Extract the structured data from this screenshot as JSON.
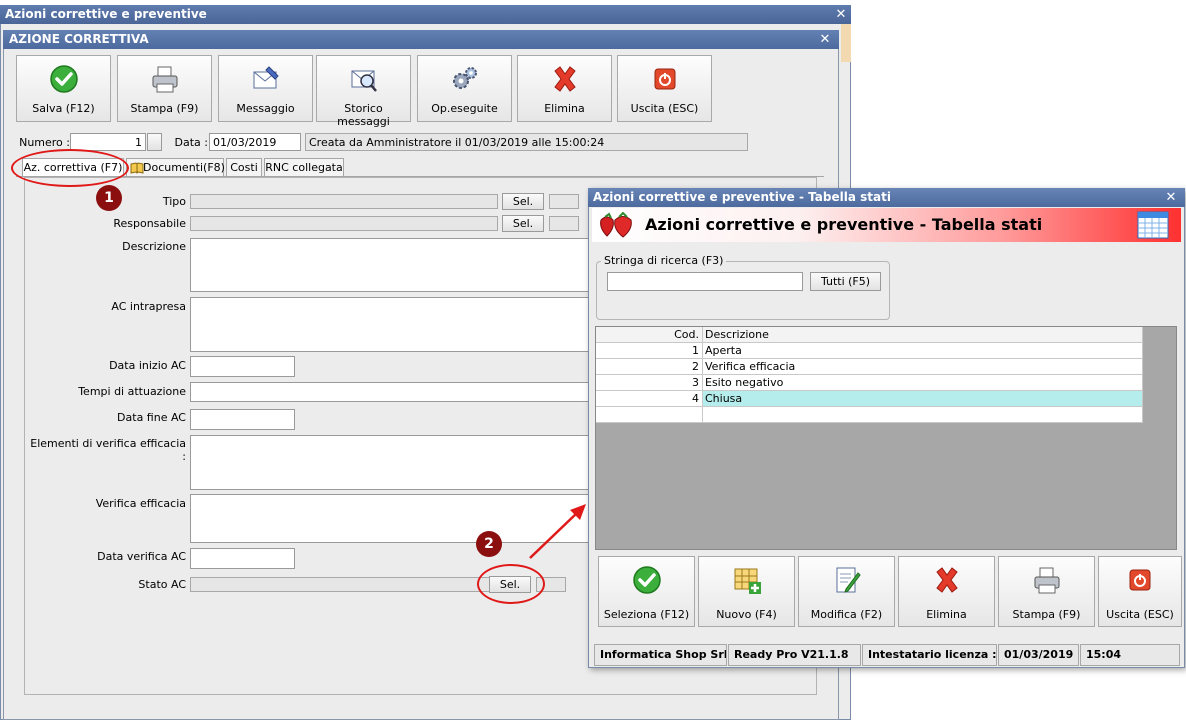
{
  "outer_window": {
    "title": "Azioni correttive e preventive",
    "close": "✕"
  },
  "inner_window": {
    "title": "AZIONE CORRETTIVA",
    "close": "✕"
  },
  "toolbar": [
    {
      "label": "Salva (F12)",
      "icon": "save-check-icon"
    },
    {
      "label": "Stampa (F9)",
      "icon": "printer-icon"
    },
    {
      "label": "Messaggio",
      "icon": "message-icon"
    },
    {
      "label": "Storico messaggi",
      "icon": "message-history-icon"
    },
    {
      "label": "Op.eseguite",
      "icon": "gears-icon"
    },
    {
      "label": "Elimina",
      "icon": "delete-x-icon"
    },
    {
      "label": "Uscita (ESC)",
      "icon": "exit-icon"
    }
  ],
  "header_fields": {
    "numero_label": "Numero :",
    "numero_value": "1",
    "data_label": "Data :",
    "data_value": "01/03/2019",
    "created_info": "Creata da Amministratore il 01/03/2019 alle 15:00:24"
  },
  "tabs": [
    "Az. correttiva (F7)",
    "Documenti(F8)",
    "Costi",
    "RNC collegata"
  ],
  "form": {
    "tipo": "Tipo",
    "responsabile": "Responsabile",
    "descrizione": "Descrizione",
    "ac_intrapresa": "AC intrapresa",
    "data_inizio": "Data inizio AC",
    "tempi": "Tempi di attuazione",
    "data_fine": "Data fine AC",
    "elementi": "Elementi di verifica efficacia :",
    "verifica": "Verifica efficacia",
    "data_verifica": "Data verifica AC",
    "stato": "Stato AC",
    "sel": "Sel."
  },
  "badges": {
    "one": "1",
    "two": "2"
  },
  "dialog": {
    "title": "Azioni correttive e preventive - Tabella stati",
    "close": "✕",
    "header": "Azioni correttive e preventive - Tabella stati",
    "search_group": "Stringa di ricerca (F3)",
    "search_value": "",
    "tutti": "Tutti (F5)",
    "columns": {
      "cod": "Cod.",
      "descrizione": "Descrizione"
    },
    "rows": [
      {
        "cod": "1",
        "descrizione": "Aperta"
      },
      {
        "cod": "2",
        "descrizione": "Verifica efficacia"
      },
      {
        "cod": "3",
        "descrizione": "Esito negativo"
      },
      {
        "cod": "4",
        "descrizione": "Chiusa"
      }
    ],
    "buttons": [
      {
        "label": "Seleziona (F12)",
        "icon": "select-check-icon"
      },
      {
        "label": "Nuovo (F4)",
        "icon": "new-grid-icon"
      },
      {
        "label": "Modifica (F2)",
        "icon": "edit-document-icon"
      },
      {
        "label": "Elimina",
        "icon": "delete-x-icon"
      },
      {
        "label": "Stampa (F9)",
        "icon": "printer-icon"
      },
      {
        "label": "Uscita (ESC)",
        "icon": "exit-icon"
      }
    ],
    "status": [
      "Informatica Shop Srl",
      "Ready Pro V21.1.8",
      "Intestatario licenza : C",
      "01/03/2019",
      "15:04"
    ]
  }
}
